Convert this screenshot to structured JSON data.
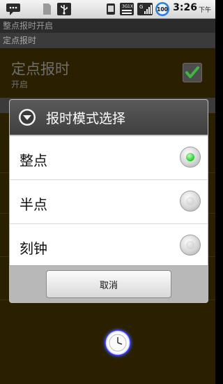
{
  "status_bar": {
    "time": "3:26",
    "ampm": "下午",
    "battery": "100",
    "signal_labels": [
      "3G",
      "1X",
      "G"
    ]
  },
  "app_title": "整点报时开启",
  "section_header": "定点报时",
  "pref": {
    "title": "定点报时",
    "summary": "开启",
    "checked": true
  },
  "dialog": {
    "title": "报时模式选择",
    "options": [
      {
        "label": "整点",
        "selected": true
      },
      {
        "label": "半点",
        "selected": false
      },
      {
        "label": "刻钟",
        "selected": false
      }
    ],
    "cancel_label": "取消"
  },
  "colors": {
    "radio_selected": "#39d03a",
    "checkbox_mark": "#3fb63f"
  }
}
